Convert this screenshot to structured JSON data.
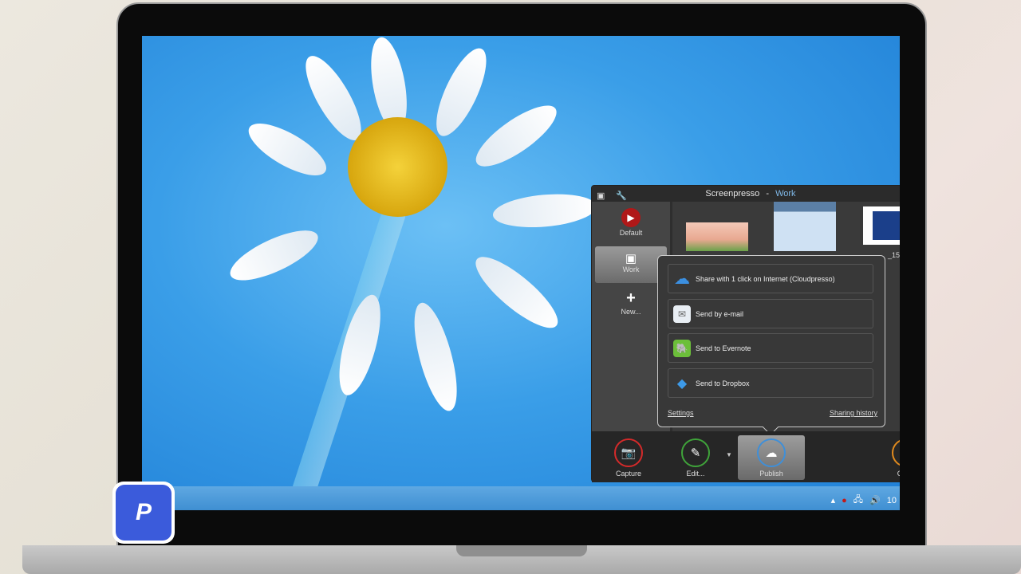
{
  "window": {
    "app": "Screenpresso",
    "separator": "-",
    "workspace": "Work"
  },
  "sidebar": {
    "items": [
      {
        "label": "Default",
        "icon": "screenpresso-logo-icon"
      },
      {
        "label": "Work",
        "icon": "drawer-icon"
      },
      {
        "label": "New...",
        "icon": "plus-icon"
      }
    ]
  },
  "thumbnails": {
    "partial_label": "_15"
  },
  "publish_menu": {
    "items": [
      {
        "label": "Share with 1 click on Internet (Cloudpresso)",
        "icon": "cloud-icon"
      },
      {
        "label": "Send by e-mail",
        "icon": "envelope-icon"
      },
      {
        "label": "Send to Evernote",
        "icon": "evernote-icon"
      },
      {
        "label": "Send to Dropbox",
        "icon": "dropbox-icon"
      }
    ],
    "settings": "Settings",
    "history": "Sharing history"
  },
  "toolbar": {
    "capture": "Capture",
    "edit": "Edit...",
    "publish": "Publish",
    "partial": "C"
  },
  "taskbar": {
    "clock_partial": "10"
  },
  "colors": {
    "capture": "#d42a2a",
    "edit": "#3fa33a",
    "publish": "#3f8fd8",
    "accent": "#7fb8e8"
  }
}
